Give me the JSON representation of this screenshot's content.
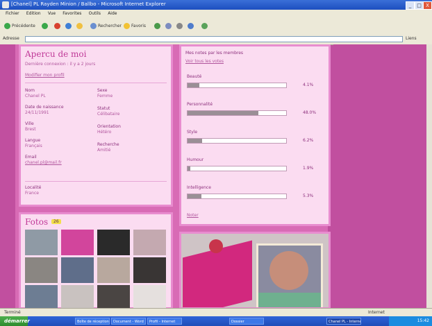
{
  "window": {
    "title": "[Chanel] PL Rayden Minion / Ballbo - Microsoft Internet Explorer",
    "minimize": "_",
    "maximize": "□",
    "close": "X"
  },
  "menu": [
    "Fichier",
    "Edition",
    "Vue",
    "Favorites",
    "Outils",
    "Aide"
  ],
  "toolbar": {
    "back": "Précédente",
    "search": "Rechercher",
    "favorites": "Favoris"
  },
  "address": {
    "label": "Adresse",
    "url": "",
    "go": "Liens"
  },
  "profile": {
    "title": "Apercu de moi",
    "subtitle": "Dernière connexion : il y a 2 jours",
    "link": "Modifier mon profil",
    "left_fields": [
      {
        "label": "Nom",
        "value": "Chanel PL"
      },
      {
        "label": "Date de naissance",
        "value": "24/11/1991"
      },
      {
        "label": "Ville",
        "value": "Brest"
      },
      {
        "label": "Langue",
        "value": "Français"
      },
      {
        "label": "Email",
        "value": "chanel.pl@mail.fr"
      }
    ],
    "right_fields": [
      {
        "label": "Sexe",
        "value": "Femme"
      },
      {
        "label": "Statut",
        "value": "Célibataire"
      },
      {
        "label": "Orientation",
        "value": "Hétéro"
      },
      {
        "label": "Recherche",
        "value": "Amitié"
      }
    ],
    "footer_label": "Localité",
    "footer_value": "France"
  },
  "stats": {
    "title": "Mes notes par les membres",
    "subtitle": "Voir tous les votes",
    "rows": [
      {
        "label": "Beauté",
        "pct": "4.1%",
        "fill": 0.12
      },
      {
        "label": "Personnalité",
        "pct": "48.0%",
        "fill": 0.72
      },
      {
        "label": "Style",
        "pct": "6.2%",
        "fill": 0.15
      },
      {
        "label": "Humour",
        "pct": "1.9%",
        "fill": 0.03
      },
      {
        "label": "Intelligence",
        "pct": "5.3%",
        "fill": 0.14
      }
    ],
    "footer": "Noter"
  },
  "photos": {
    "title": "Fotos",
    "badge": "26",
    "thumbs": [
      "#8f9aa5",
      "#d2459c",
      "#2a2a2a",
      "#c4a9b0",
      "#8a8682",
      "#5f6e8a",
      "#b8a89e",
      "#393534",
      "#6d7d93",
      "#c9c2c0",
      "#4a4543",
      "#e5e0de"
    ]
  },
  "status": {
    "text": "Terminé",
    "zone": "Internet"
  },
  "taskbar": {
    "start": "démarrer",
    "tasks": [
      "Boîte de réception",
      "Document - Word",
      "Profil - Internet",
      "Dossier",
      "Chanel PL - Internet"
    ],
    "time": "15:42"
  }
}
